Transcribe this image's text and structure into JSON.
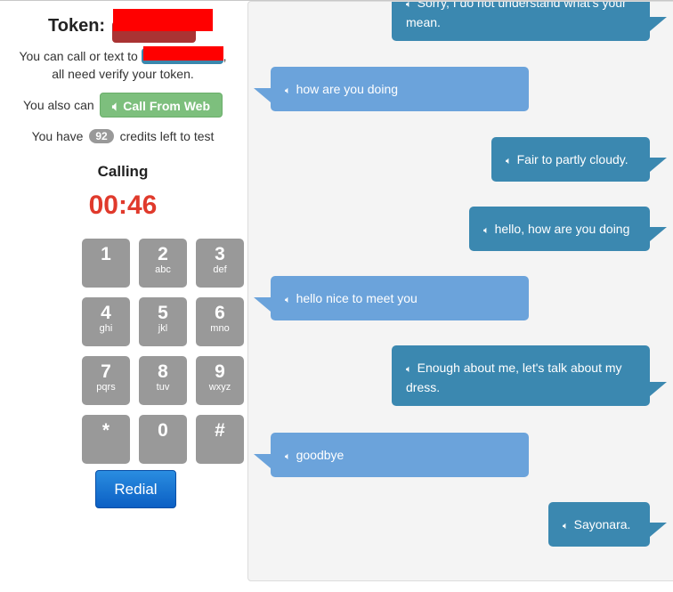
{
  "header": {
    "token_label": "Token:",
    "token_value": "██████"
  },
  "info": {
    "call_prefix": "You can call or text to",
    "call_suffix": ",",
    "verify_text": "all need verify your token.",
    "also_text": "You also can",
    "web_button": "Call From Web",
    "credits_prefix": "You have",
    "credits_value": "92",
    "credits_suffix": "credits left to test"
  },
  "call": {
    "status": "Calling",
    "timer": "00:46"
  },
  "keypad": [
    {
      "digit": "1",
      "letters": ""
    },
    {
      "digit": "2",
      "letters": "abc"
    },
    {
      "digit": "3",
      "letters": "def"
    },
    {
      "digit": "4",
      "letters": "ghi"
    },
    {
      "digit": "5",
      "letters": "jkl"
    },
    {
      "digit": "6",
      "letters": "mno"
    },
    {
      "digit": "7",
      "letters": "pqrs"
    },
    {
      "digit": "8",
      "letters": "tuv"
    },
    {
      "digit": "9",
      "letters": "wxyz"
    },
    {
      "digit": "*",
      "letters": ""
    },
    {
      "digit": "0",
      "letters": ""
    },
    {
      "digit": "#",
      "letters": ""
    }
  ],
  "redial_label": "Redial",
  "messages": [
    {
      "side": "bot",
      "text": "Sorry, I do not understand what's your mean."
    },
    {
      "side": "user",
      "text": "how are you doing"
    },
    {
      "side": "bot",
      "text": "Fair to partly cloudy."
    },
    {
      "side": "bot",
      "text": "hello, how are you doing"
    },
    {
      "side": "user",
      "text": "hello nice to meet you"
    },
    {
      "side": "bot",
      "text": "Enough about me, let's talk about my dress."
    },
    {
      "side": "user",
      "text": "goodbye"
    },
    {
      "side": "bot",
      "text": "Sayonara."
    }
  ],
  "icons": {
    "speaker": "speaker-icon"
  },
  "colors": {
    "user_bubble": "#6ba3db",
    "bot_bubble": "#3b88b0",
    "timer": "#e03a2c",
    "web_button": "#7dbf7d",
    "redial": "#0b5fc4",
    "key": "#999999"
  }
}
